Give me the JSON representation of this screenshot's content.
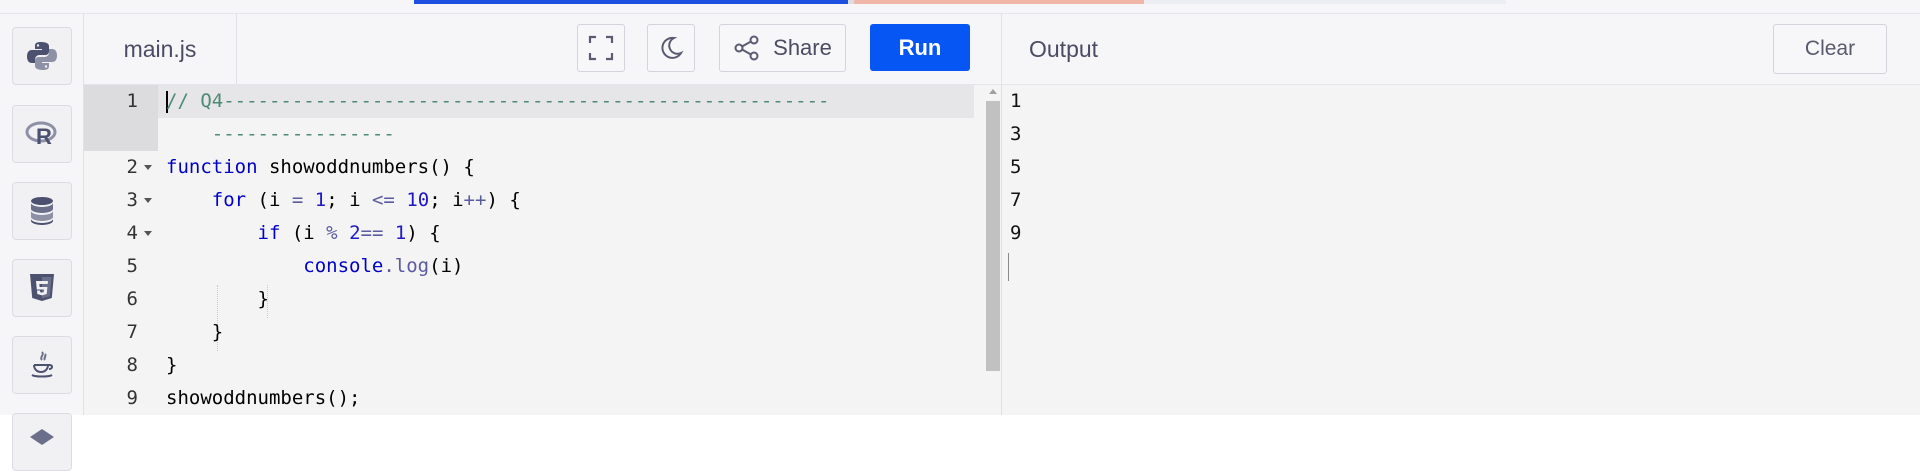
{
  "editor": {
    "file_name": "main.js",
    "share_label": "Share",
    "run_label": "Run",
    "line_numbers": [
      "1",
      "2",
      "3",
      "4",
      "5",
      "6",
      "7",
      "8",
      "9"
    ],
    "code_lines": [
      "// Q4-----------------------------------------------------",
      "    ----------------",
      "function showoddnumbers() {",
      "    for (i = 1; i <= 10; i++) {",
      "        if (i % 2== 1) {",
      "            console.log(i)",
      "        }",
      "    }",
      "}",
      "showoddnumbers();"
    ]
  },
  "output": {
    "title": "Output",
    "clear_label": "Clear",
    "lines": [
      "1",
      "3",
      "5",
      "7",
      "9"
    ]
  },
  "sidebar": {
    "languages": [
      "python-icon",
      "r-icon",
      "database-icon",
      "html5-icon",
      "java-icon",
      "more-icon"
    ]
  },
  "colors": {
    "run_button": "#0556f3",
    "keyword": "#0000c8",
    "comment": "#4c8a73"
  }
}
